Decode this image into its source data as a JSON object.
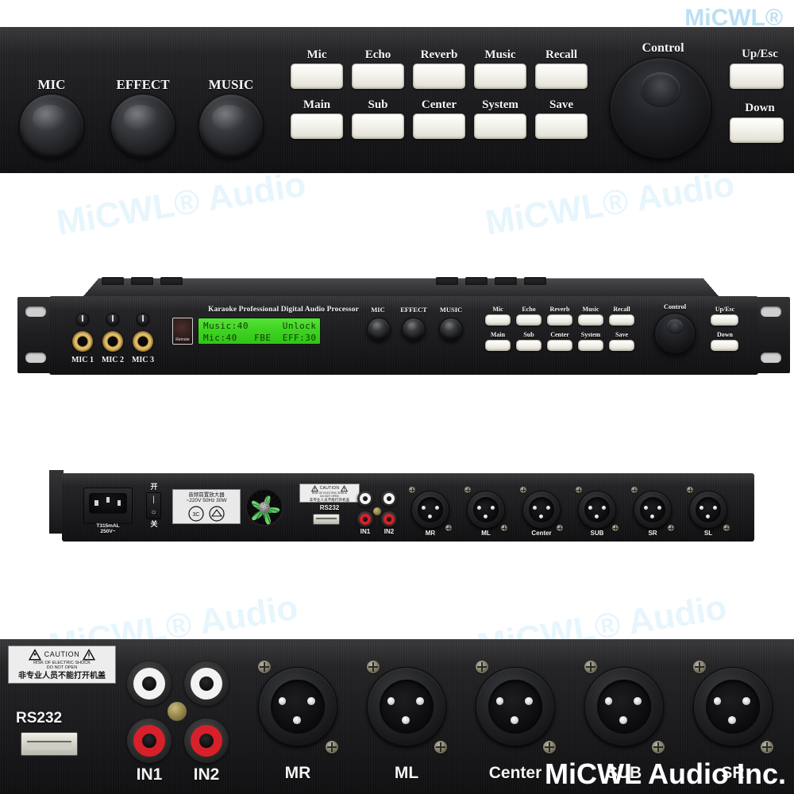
{
  "brand": {
    "logo_top": "MiCWL®",
    "watermark": "MiCWL® Audio",
    "watermark_bottom": "MiCWL Audio Inc."
  },
  "product": {
    "title": "Karaoke Professional Digital Audio Processor"
  },
  "front_panel": {
    "knobs": [
      {
        "label": "MIC"
      },
      {
        "label": "EFFECT"
      },
      {
        "label": "MUSIC"
      }
    ],
    "buttons_row1": [
      {
        "label": "Mic"
      },
      {
        "label": "Echo"
      },
      {
        "label": "Reverb"
      },
      {
        "label": "Music"
      },
      {
        "label": "Recall"
      }
    ],
    "buttons_row2": [
      {
        "label": "Main"
      },
      {
        "label": "Sub"
      },
      {
        "label": "Center"
      },
      {
        "label": "System"
      },
      {
        "label": "Save"
      }
    ],
    "control": {
      "label": "Control"
    },
    "nav_buttons": [
      {
        "label": "Up/Esc"
      },
      {
        "label": "Down"
      }
    ],
    "mic_inputs": [
      {
        "label": "MIC 1"
      },
      {
        "label": "MIC 2"
      },
      {
        "label": "MIC 3"
      }
    ],
    "remote_label": "Remote",
    "lcd": {
      "line1": "Music:40      Unlock",
      "line2": "Mic:40   FBE  EFF:30",
      "background": "#3fd421",
      "text_color": "#123a06"
    }
  },
  "rear_panel": {
    "power": {
      "switch_on_label": "开",
      "switch_off_label": "关",
      "fuse_label_line1": "T315mAL",
      "fuse_label_line2": "250V~"
    },
    "rating_label": {
      "line1": "音频前置放大器",
      "line2": "~220V  50Hz  30W"
    },
    "caution_label": {
      "title": "CAUTION",
      "line1": "RISK OF ELECTRIC SHOCK",
      "line2": "DO NOT OPEN",
      "chinese": "非专业人员不能打开机盖"
    },
    "rs232_label": "RS232",
    "rca_inputs": [
      {
        "label": "IN1"
      },
      {
        "label": "IN2"
      }
    ],
    "xlr_outputs": [
      {
        "label": "MR"
      },
      {
        "label": "ML"
      },
      {
        "label": "Center"
      },
      {
        "label": "SUB"
      },
      {
        "label": "SR"
      },
      {
        "label": "SL"
      }
    ]
  },
  "detail_panel": {
    "rs232_label": "RS232",
    "rca_inputs": [
      {
        "label": "IN1"
      },
      {
        "label": "IN2"
      }
    ],
    "xlr_outputs": [
      {
        "label": "MR"
      },
      {
        "label": "ML"
      },
      {
        "label": "Center"
      },
      {
        "label": "SUB"
      },
      {
        "label": "SR"
      }
    ],
    "caution_label": {
      "title": "CAUTION",
      "line1": "RISK OF ELECTRIC SHOCK",
      "line2": "DO NOT OPEN",
      "chinese": "非专业人员不能打开机盖"
    }
  }
}
